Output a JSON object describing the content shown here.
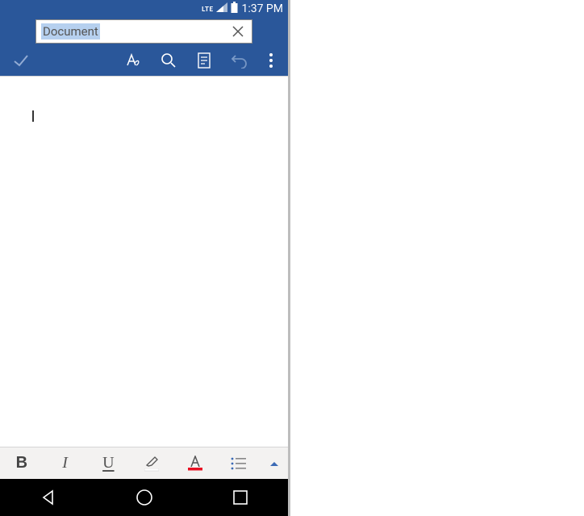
{
  "status": {
    "network": "LTE",
    "time": "1:37 PM"
  },
  "title": {
    "value": "Document"
  },
  "colors": {
    "brand": "#2a579a",
    "highlight_underline": "#ffffff",
    "fontcolor_underline": "#e81123",
    "list_accent": "#3b6ab5"
  },
  "format": {
    "bold": "B",
    "italic": "I",
    "underline": "U"
  }
}
